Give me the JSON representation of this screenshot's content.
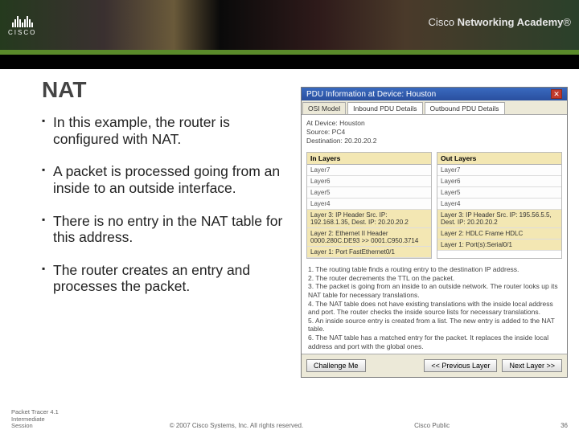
{
  "banner": {
    "logo_text": "CISCO",
    "academy_prefix": "Cisco ",
    "academy_bold": "Networking Academy",
    "academy_suffix": "®"
  },
  "slide": {
    "title": "NAT",
    "bullets": [
      "In this example, the router is configured with NAT.",
      "A packet is processed going from an inside to an outside interface.",
      "There is no entry in the NAT table for this address.",
      "The router creates an entry and processes the packet."
    ]
  },
  "window": {
    "title": "PDU Information at Device: Houston",
    "tabs": [
      "OSI Model",
      "Inbound PDU Details",
      "Outbound PDU Details"
    ],
    "meta": {
      "at_device_label": "At Device: Houston",
      "source_label": "Source: PC4",
      "dest_label": "Destination: 20.20.20.2"
    },
    "in_header": "In Layers",
    "out_header": "Out Layers",
    "in_layers": [
      "Layer7",
      "Layer6",
      "Layer5",
      "Layer4",
      "Layer 3: IP Header Src. IP: 192.168.1.35, Dest. IP: 20.20.20.2",
      "Layer 2: Ethernet II Header 0000.280C.DE93 >> 0001.C950.3714",
      "Layer 1: Port FastEthernet0/1"
    ],
    "out_layers": [
      "Layer7",
      "Layer6",
      "Layer5",
      "Layer4",
      "Layer 3: IP Header Src. IP: 195.56.5.5, Dest. IP: 20.20.20.2",
      "Layer 2: HDLC Frame HDLC",
      "Layer 1: Port(s):Serial0/1"
    ],
    "steps": [
      "1. The routing table finds a routing entry to the destination IP address.",
      "2. The router decrements the TTL on the packet.",
      "3. The packet is going from an inside to an outside network. The router looks up its NAT table for necessary translations.",
      "4. The NAT table does not have existing translations with the inside local address and port. The router checks the inside source lists for necessary translations.",
      "5. An inside source entry is created from a list. The new entry is added to the NAT table.",
      "6. The NAT table has a matched entry for the packet. It replaces the inside local address and port with the global ones."
    ],
    "buttons": {
      "challenge": "Challenge Me",
      "prev": "<< Previous Layer",
      "next": "Next Layer >>"
    }
  },
  "footer": {
    "left_l1": "Packet Tracer 4.1",
    "left_l2": "Intermediate",
    "left_l3": "Session",
    "center": "© 2007 Cisco Systems, Inc. All rights reserved.",
    "right": "Cisco Public",
    "page": "36"
  }
}
